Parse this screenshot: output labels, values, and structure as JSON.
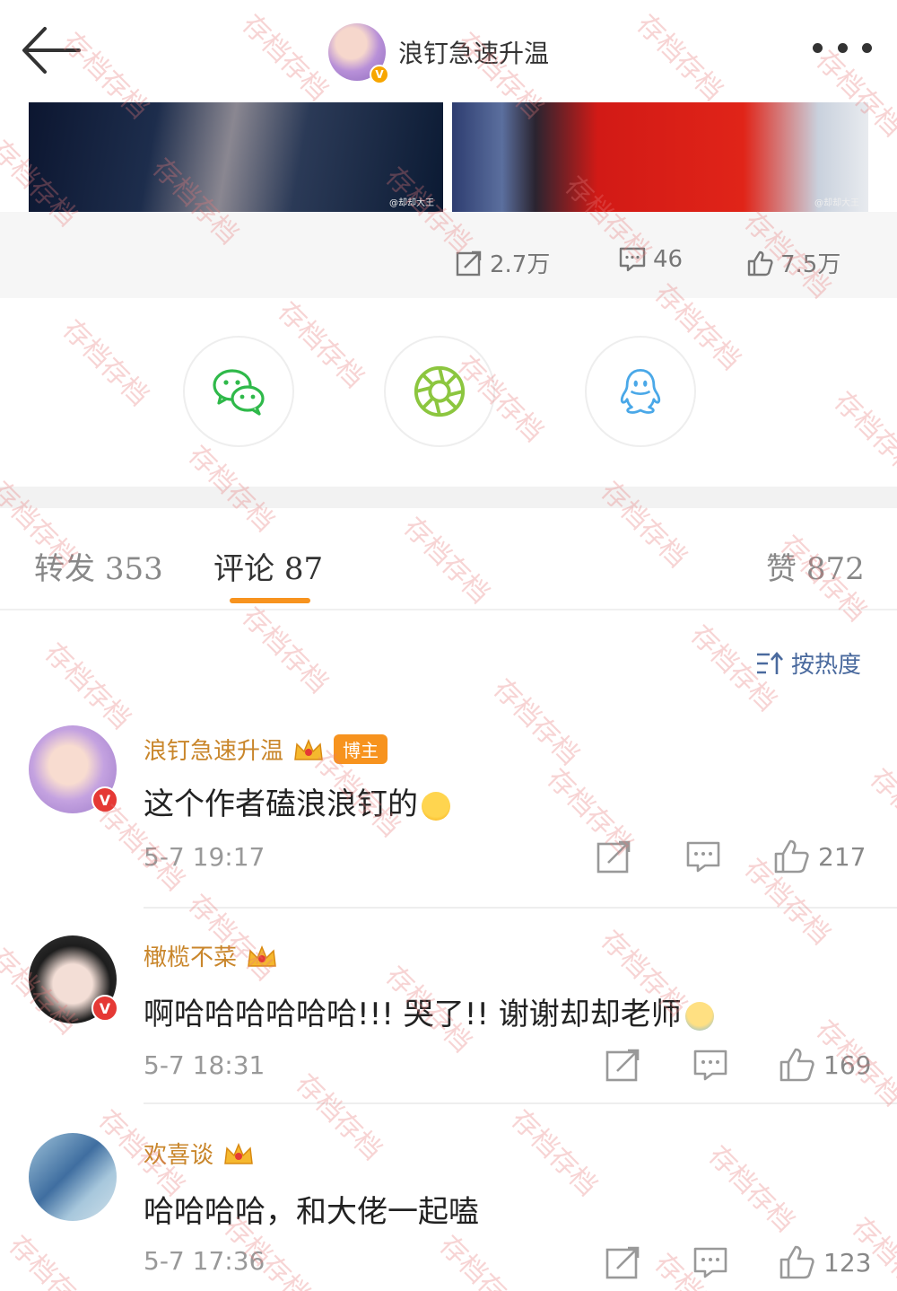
{
  "header": {
    "title": "浪钉急速升温",
    "avatar_badge": "V"
  },
  "images": [
    {
      "watermark": "@却却大王"
    },
    {
      "watermark": "@却却大王"
    }
  ],
  "stats": {
    "repost": "2.7万",
    "comments": "46",
    "likes": "7.5万"
  },
  "share": {
    "icons": [
      "wechat-icon",
      "moments-icon",
      "qq-icon"
    ]
  },
  "tabs": {
    "repost_label": "转发",
    "repost_count": "353",
    "comment_label": "评论",
    "comment_count": "87",
    "like_label": "赞",
    "like_count": "872"
  },
  "sort": {
    "label": "按热度"
  },
  "comments": [
    {
      "name": "浪钉急速升温",
      "badge": "博主",
      "text": "这个作者磕浪浪钉的",
      "time": "5-7 19:17",
      "likes": "217"
    },
    {
      "name": "橄榄不菜",
      "text": "啊哈哈哈哈哈哈!!! 哭了!! 谢谢却却老师",
      "time": "5-7 18:31",
      "likes": "169"
    },
    {
      "name": "欢喜谈",
      "text": "哈哈哈哈，和大佬一起嗑",
      "time": "5-7 17:36",
      "likes": "123"
    }
  ],
  "watermark_text": "存档存档",
  "colors": {
    "accent": "#f7931e",
    "name": "#c9862b",
    "sort": "#4a6a9e",
    "wechat": "#2fb94a",
    "moments": "#8cc63f",
    "qq": "#4aa8e8"
  }
}
